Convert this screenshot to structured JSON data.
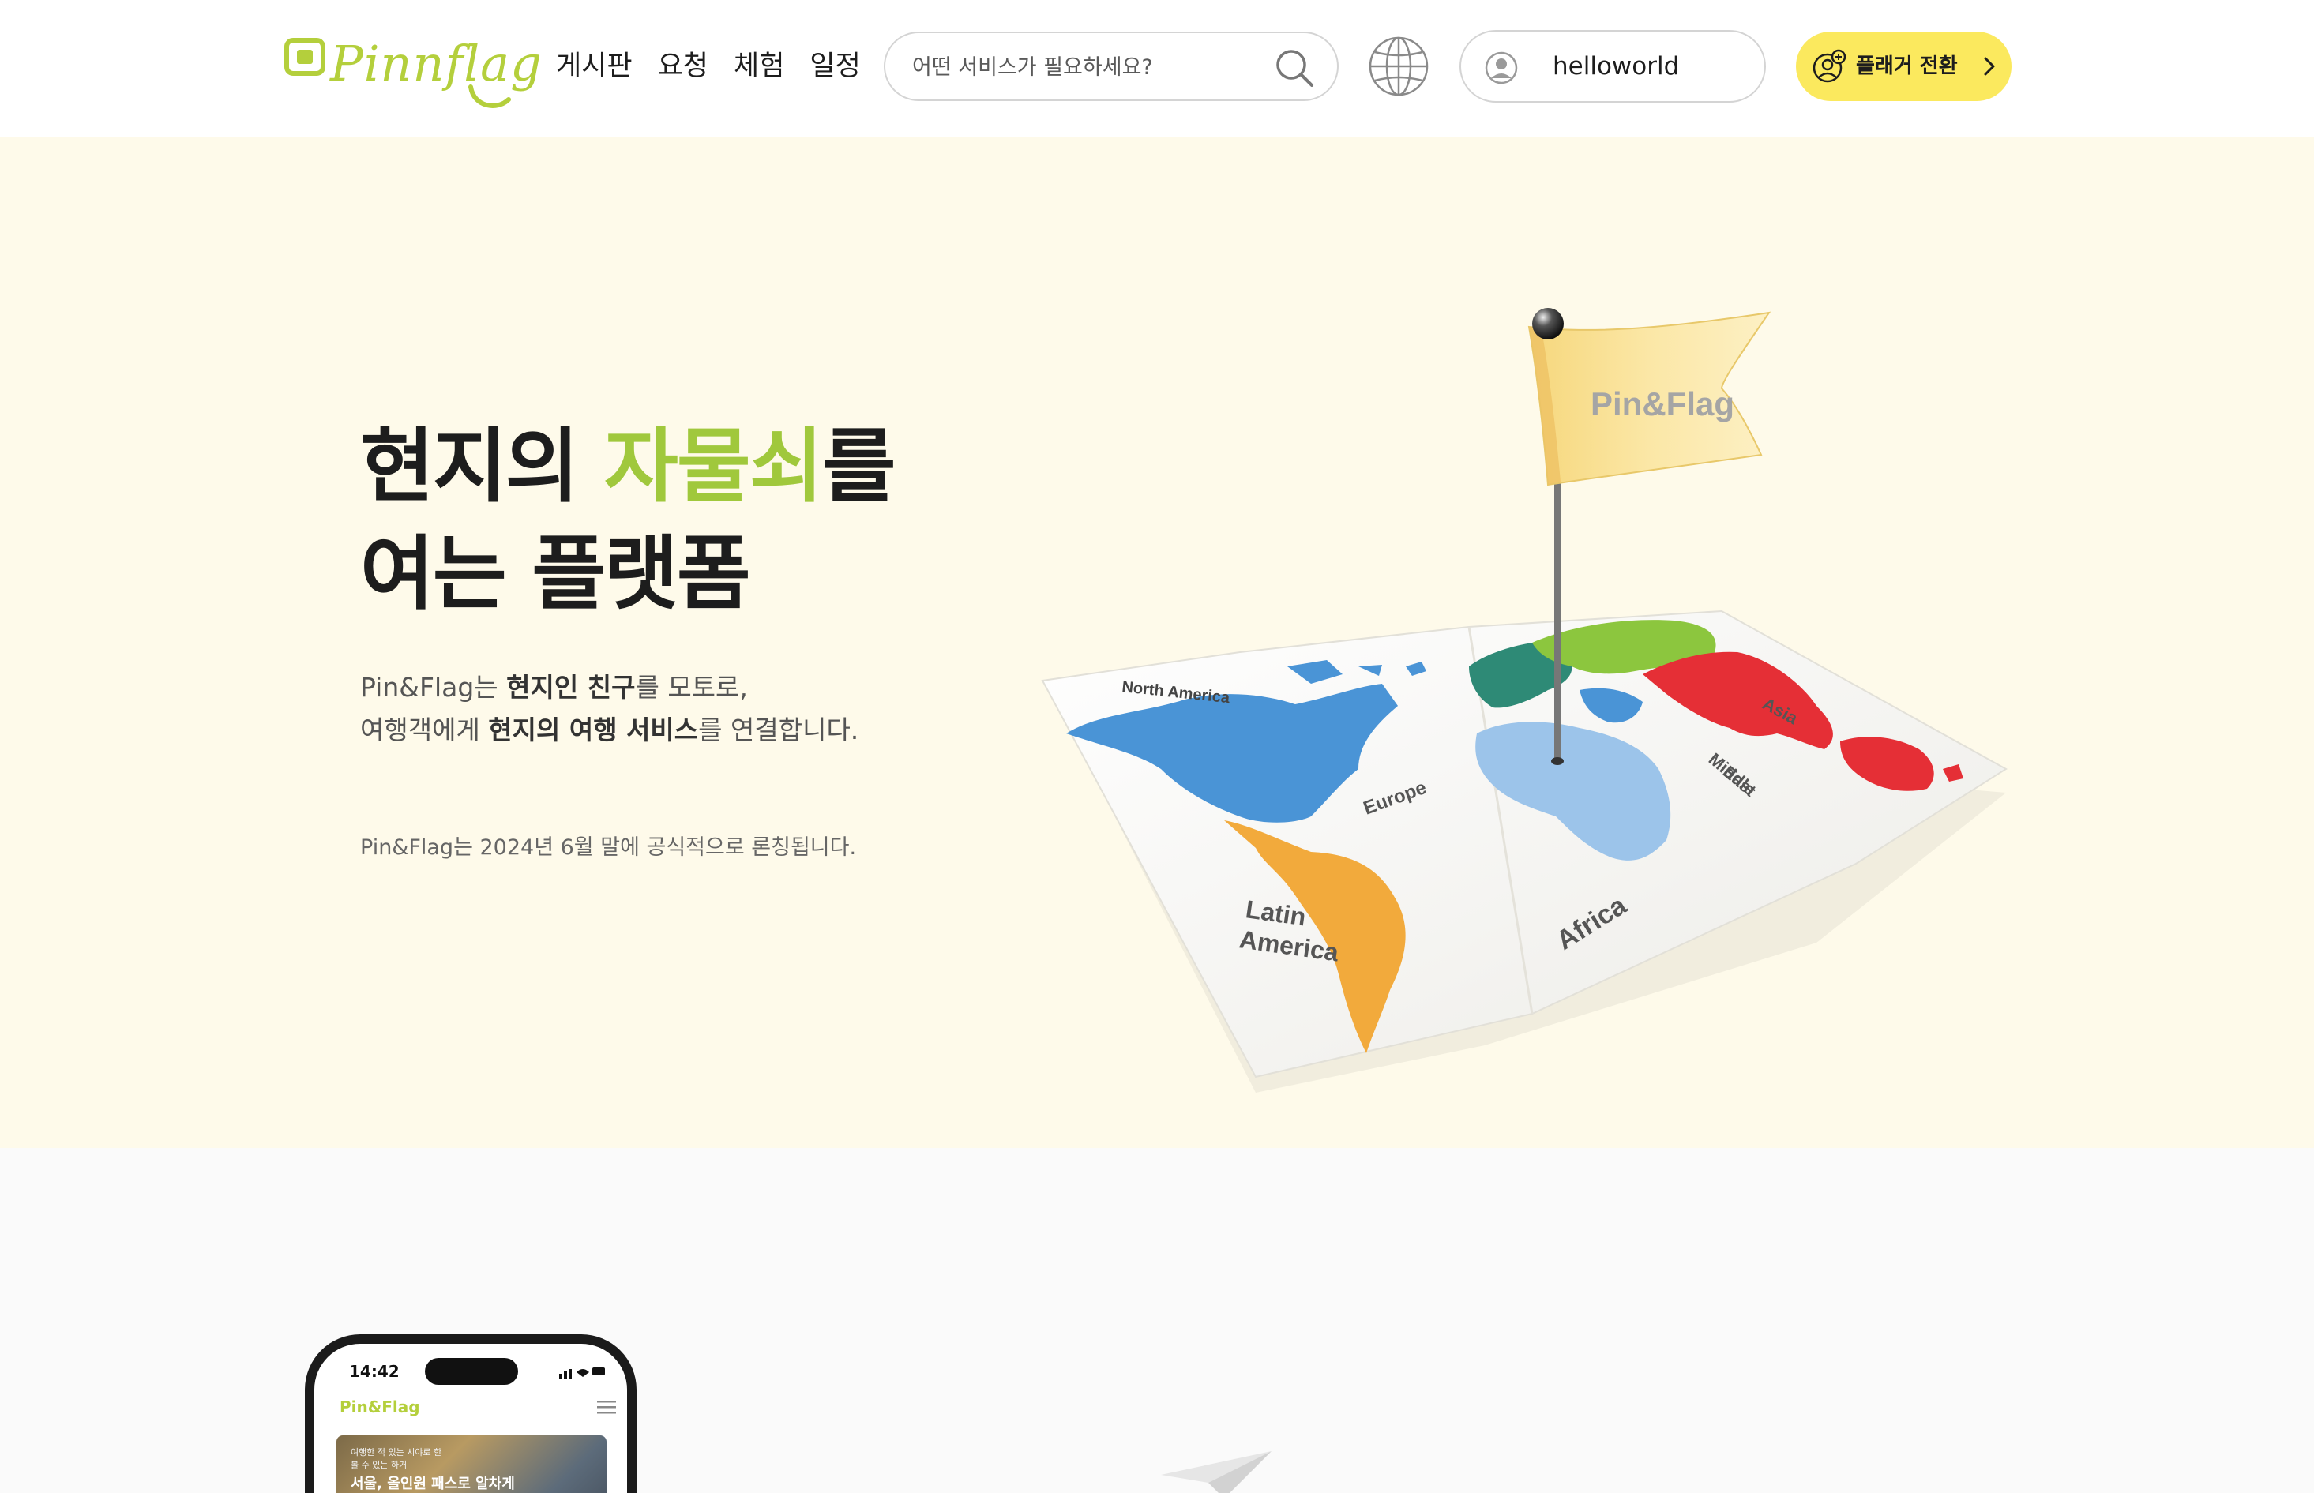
{
  "header": {
    "logo_text": "Pinnflag",
    "nav": [
      "게시판",
      "요청",
      "체험",
      "일정"
    ],
    "search": {
      "placeholder": "어떤 서비스가 필요하세요?"
    },
    "user": {
      "name": "helloworld"
    },
    "switch_button": {
      "label": "플래거 전환"
    }
  },
  "hero": {
    "title_line1_pre": "현지의 ",
    "title_line1_accent": "자물쇠",
    "title_line1_post": "를",
    "title_line2": "여는 플랫폼",
    "desc_line1": {
      "t1": "Pin&Flag는 ",
      "b1": "현지인 친구",
      "t2": "를 모토로,"
    },
    "desc_line2": {
      "t1": "여행객에게 ",
      "b1": "현지의 여행 서비스",
      "t2": "를 연결합니다."
    },
    "launch_note": "Pin&Flag는 2024년 6월 말에 공식적으로 론칭됩니다.",
    "map": {
      "flag_text": "Pin&Flag",
      "labels": {
        "north_america": "North America",
        "europe": "Europe",
        "asia": "Asia",
        "middle_east_1": "Middle",
        "middle_east_2": "East",
        "latin_america_1": "Latin",
        "latin_america_2": "America",
        "africa": "Africa"
      }
    }
  },
  "section2": {
    "phone": {
      "time": "14:42",
      "brand": "Pin&Flag",
      "card_small_1": "여행한 적 있는 시야로 한",
      "card_small_2": "볼 수 있는 하거",
      "card_title": "서울, 올인원 패스로 알차게"
    }
  },
  "colors": {
    "accent_green": "#a0c83c",
    "logo_green": "#b4cf3c",
    "switch_yellow": "#fbe95e",
    "hero_bg": "#fefaea",
    "section2_bg": "#fafafa"
  },
  "icons": [
    "logo-mark-icon",
    "search-icon",
    "globe-icon",
    "user-avatar-icon",
    "user-switch-icon",
    "chevron-right-icon",
    "menu-icon",
    "paper-plane-icon"
  ]
}
